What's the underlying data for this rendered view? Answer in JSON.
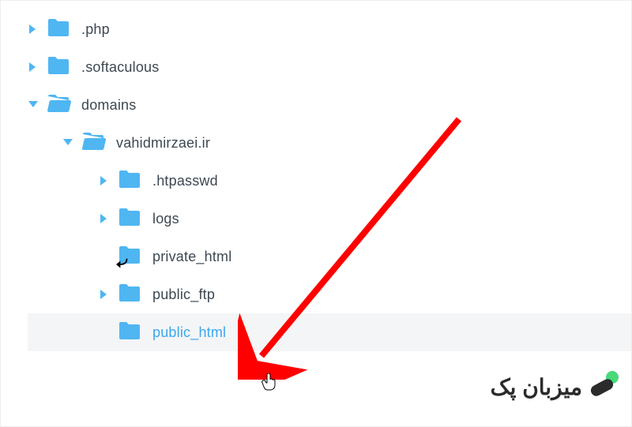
{
  "tree": {
    "php": ".php",
    "softaculous": ".softaculous",
    "domains": "domains",
    "vahidmirzaei": "vahidmirzaei.ir",
    "htpasswd": ".htpasswd",
    "logs": "logs",
    "private_html": "private_html",
    "public_ftp": "public_ftp",
    "public_html": "public_html"
  },
  "colors": {
    "folder": "#4fb6f2",
    "caret": "#4fb6f2",
    "arrow": "#ff0000",
    "accent": "#47d97a"
  },
  "watermark": {
    "text": "میزبان پک"
  }
}
